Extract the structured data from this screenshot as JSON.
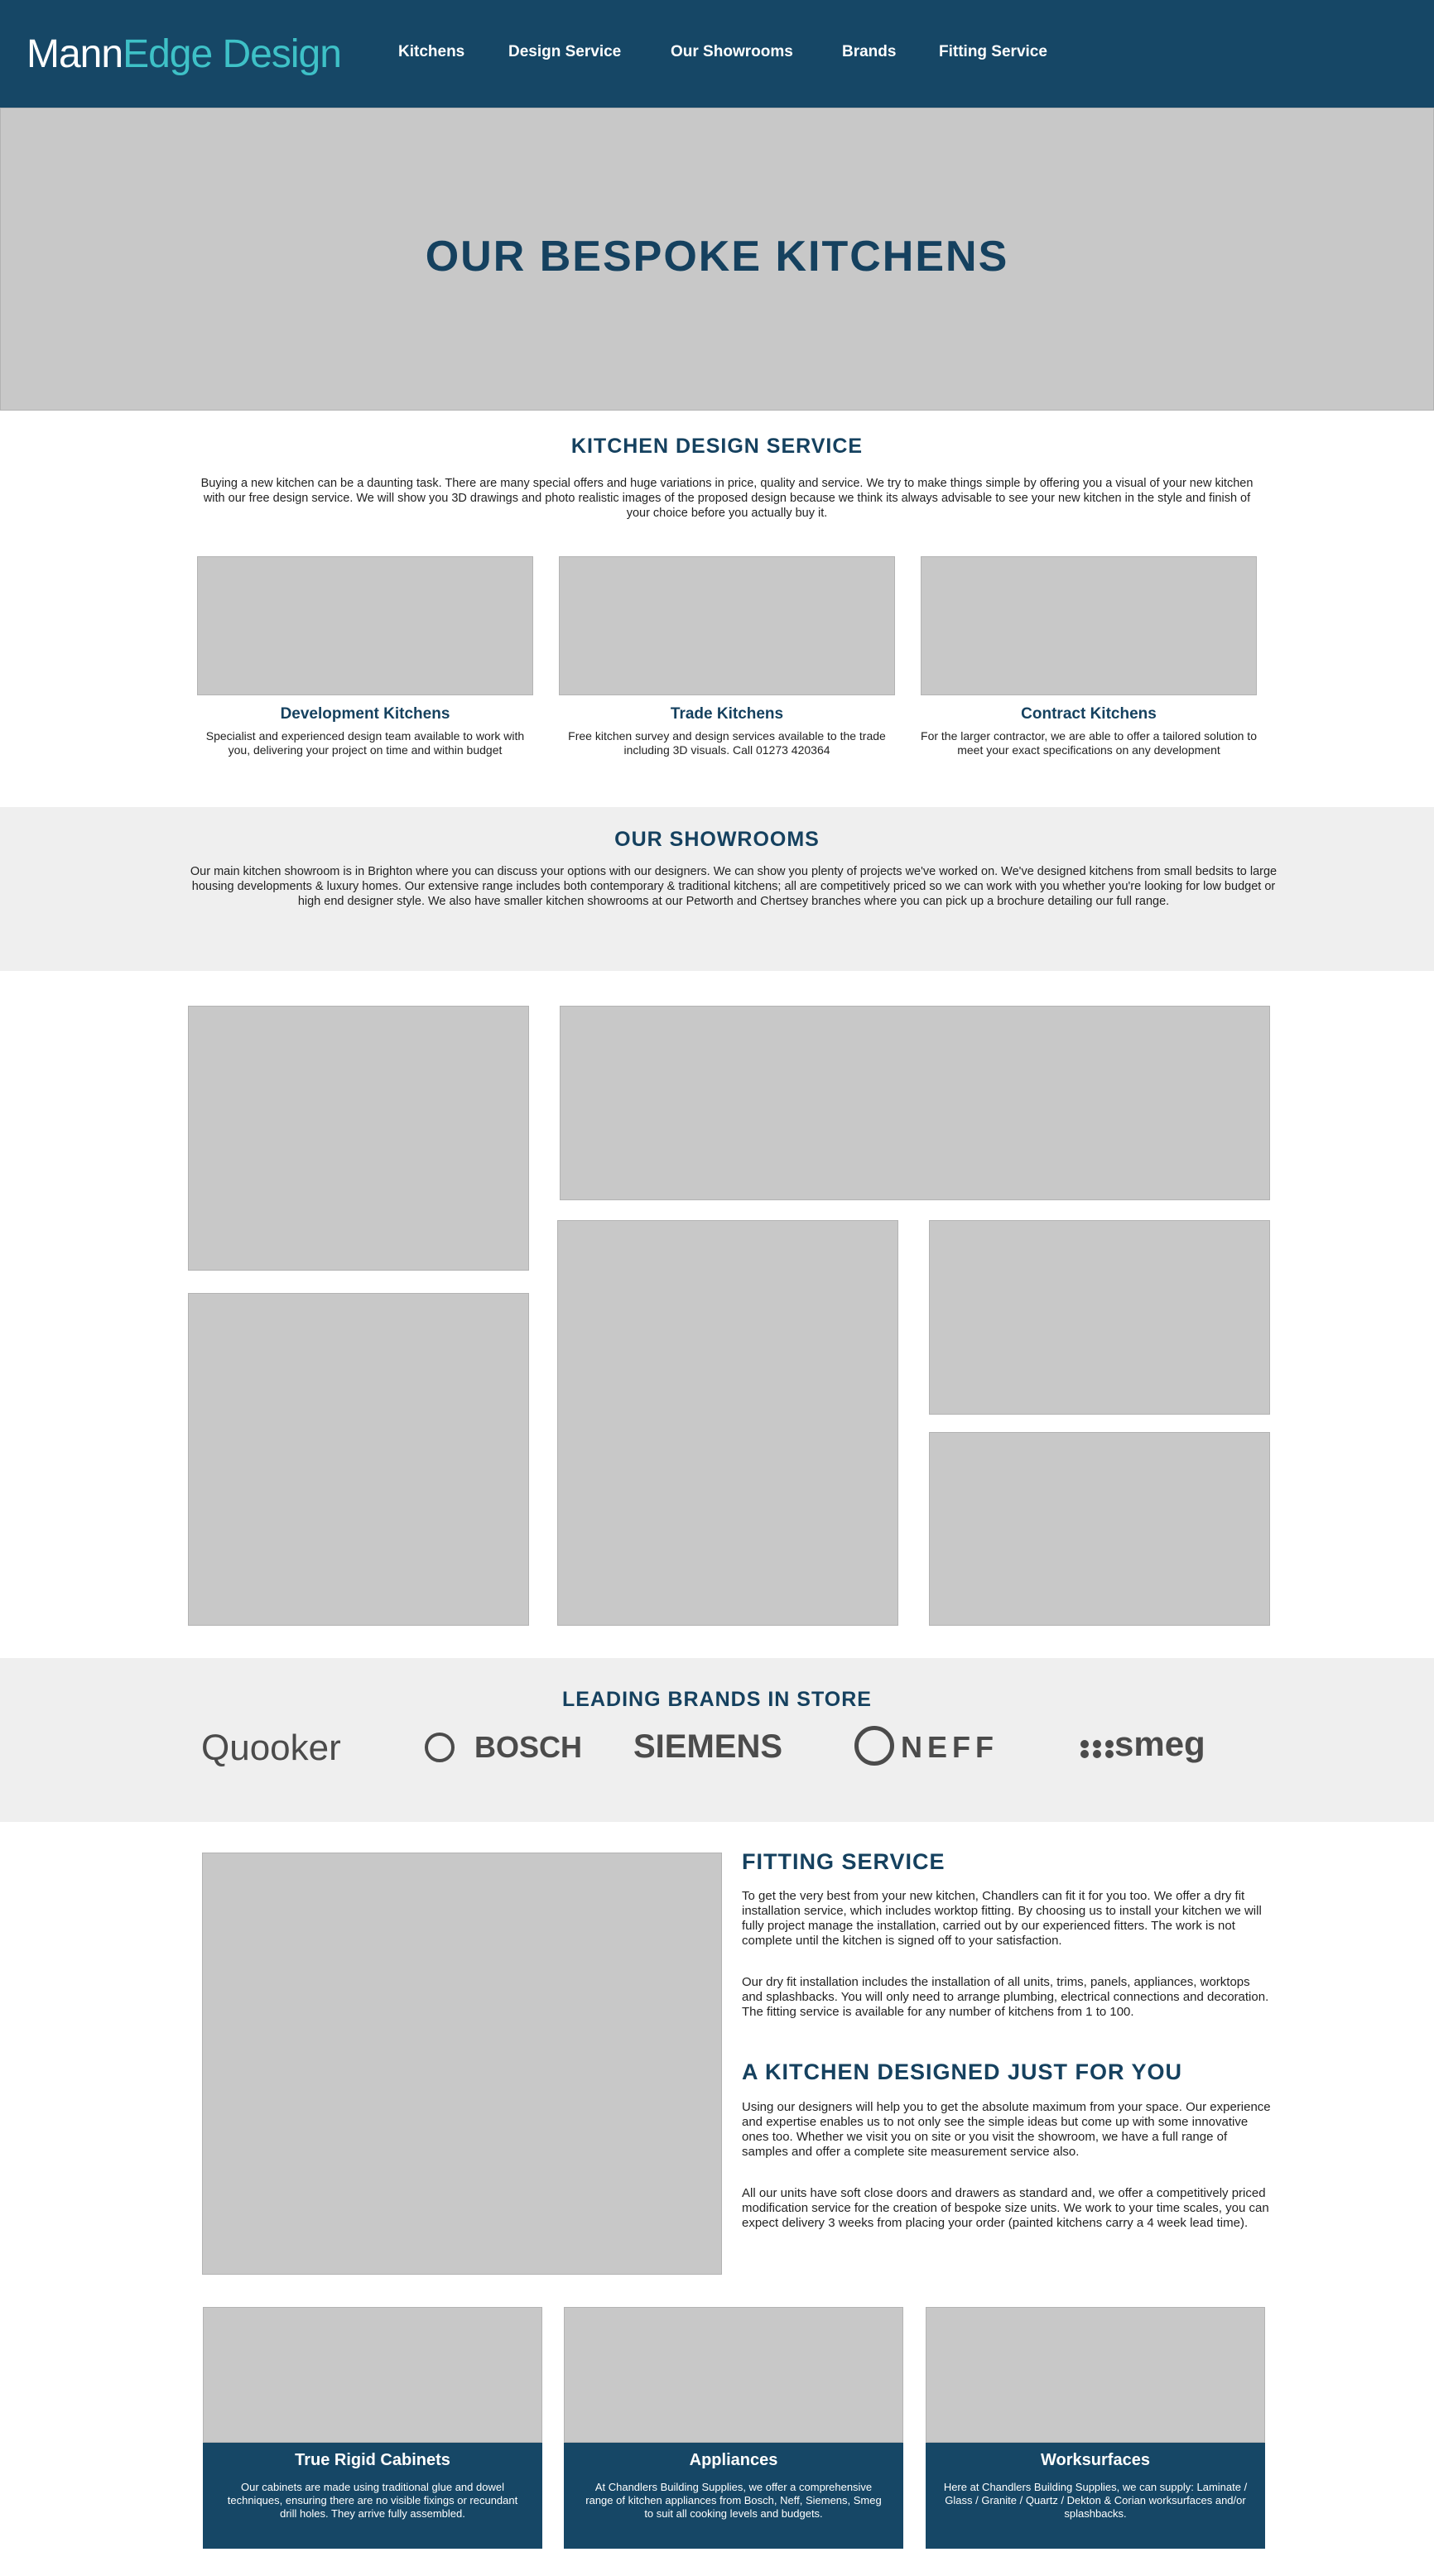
{
  "logo": {
    "part1": "Mann",
    "part2": "Edge Design"
  },
  "nav": [
    "Kitchens",
    "Design Service",
    "Our Showrooms",
    "Brands",
    "Fitting Service"
  ],
  "hero": {
    "title": "OUR BESPOKE KITCHENS"
  },
  "design_service": {
    "heading": "KITCHEN DESIGN SERVICE",
    "text": "Buying a new kitchen can be a daunting task. There are many special offers and huge variations in price, quality and service. We try to make things simple by offering you a visual of your new kitchen with our free design service. We will show you 3D drawings and photo realistic images of the proposed design because we think its always advisable to see your new kitchen in the style and finish of your choice before you actually buy it.",
    "cards": [
      {
        "title": "Development Kitchens",
        "text": "Specialist and experienced design team available to work with you, delivering your project on time and within budget"
      },
      {
        "title": "Trade Kitchens",
        "text": "Free kitchen survey and design services available to the trade including 3D visuals. Call 01273 420364"
      },
      {
        "title": "Contract Kitchens",
        "text": "For the larger contractor, we are able to offer a tailored solution to meet your exact specifications on any development"
      }
    ]
  },
  "showrooms": {
    "heading": "OUR SHOWROOMS",
    "text": "Our main kitchen showroom is in Brighton where you can discuss your options with our designers. We can show you plenty of projects we've worked on. We've designed kitchens from small bedsits to large housing developments & luxury homes. Our extensive range includes both contemporary & traditional kitchens; all are competitively priced so we can work with you whether you're looking for low budget or high end designer style. We also have smaller kitchen showrooms at our Petworth and Chertsey branches where you can pick up a brochure detailing our full range."
  },
  "brands": {
    "heading": "LEADING BRANDS IN STORE",
    "items": [
      "Quooker",
      "BOSCH",
      "SIEMENS",
      "NEFF",
      "smeg"
    ]
  },
  "fitting": {
    "heading": "FITTING SERVICE",
    "p1": "To get the very best from your new kitchen, Chandlers can fit it for you too. We offer a dry fit installation service, which includes worktop fitting. By choosing us to install your kitchen we will fully project manage the installation, carried out by our experienced fitters. The work is not complete until the kitchen is signed off to your satisfaction.",
    "p2": "Our dry fit installation includes the installation of all units, trims, panels, appliances, worktops and splashbacks. You will only need to arrange plumbing, electrical connections and decoration. The fitting service is available for any number of kitchens from 1 to 100."
  },
  "designed": {
    "heading": "A KITCHEN DESIGNED JUST FOR YOU",
    "p1": "Using our designers will help you to get the absolute maximum from your space. Our experience and expertise enables us to not only see the simple ideas but come up with some innovative ones too. Whether we visit you on site or you visit the showroom, we have a full range of samples and offer a complete site measurement service also.",
    "p2": "All our units have soft close doors and drawers as standard and, we offer a competitively priced modification service for the creation of bespoke size units. We work to your time scales, you can expect delivery 3 weeks from placing your order (painted kitchens carry a 4 week lead time)."
  },
  "features": [
    {
      "title": "True Rigid Cabinets",
      "text": "Our cabinets are made using traditional glue and dowel techniques, ensuring there are no visible fixings or recundant drill holes. They arrive fully assembled."
    },
    {
      "title": "Appliances",
      "text": "At Chandlers Building Supplies, we offer a comprehensive range of kitchen appliances from Bosch, Neff, Siemens, Smeg to suit all cooking levels and budgets."
    },
    {
      "title": "Worksurfaces",
      "text": "Here at Chandlers Building Supplies, we can supply: Laminate / Glass / Granite / Quartz / Dekton & Corian worksurfaces and/or splashbacks."
    }
  ]
}
